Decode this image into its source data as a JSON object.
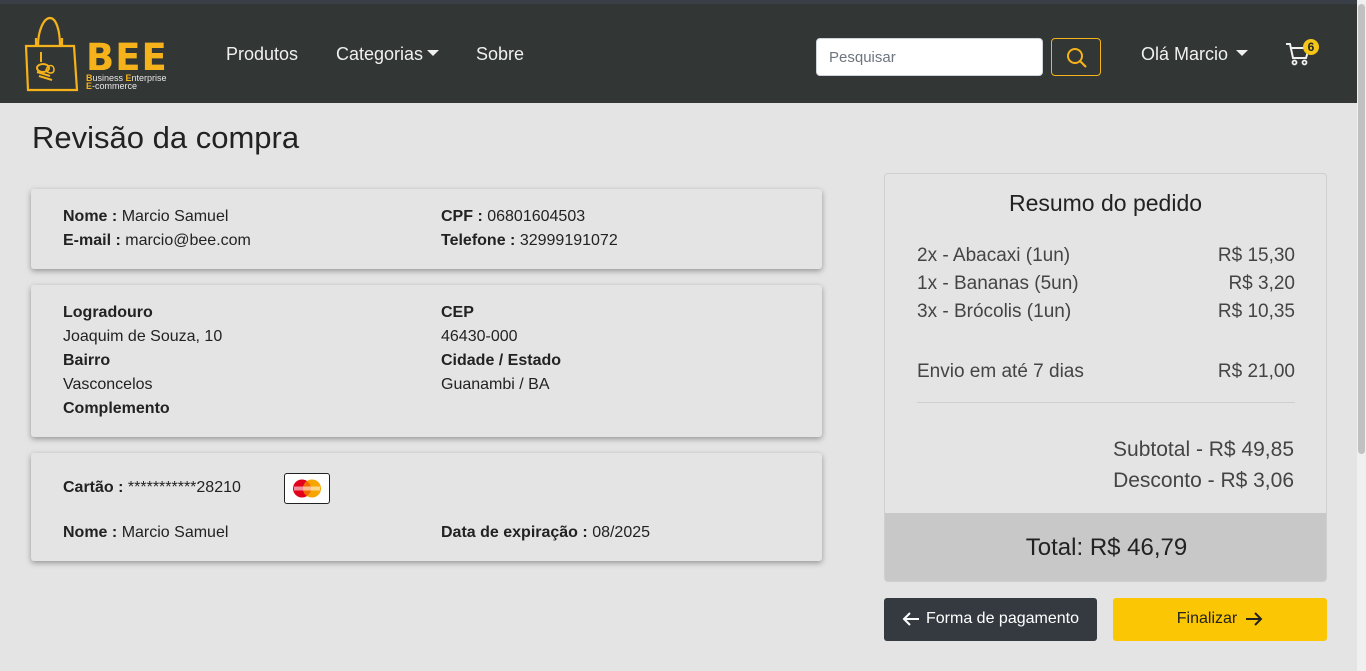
{
  "nav": {
    "brand": "BEE",
    "brand_tag_1_bold": "B",
    "brand_tag_1_rest": "usiness ",
    "brand_tag_1b_bold": "E",
    "brand_tag_1b_rest": "nterprise",
    "brand_tag_2_bold": "E",
    "brand_tag_2_rest": "-commerce",
    "links": [
      {
        "label": "Produtos"
      },
      {
        "label": "Categorias"
      },
      {
        "label": "Sobre"
      }
    ],
    "search_placeholder": "Pesquisar",
    "user_label": "Olá Marcio",
    "cart_count": "6",
    "accent_color": "#f5b21b"
  },
  "page": {
    "title": "Revisão da compra"
  },
  "customer": {
    "name_label": "Nome :",
    "name_value": "Marcio Samuel",
    "email_label": "E-mail :",
    "email_value": "marcio@bee.com",
    "cpf_label": "CPF :",
    "cpf_value": "06801604503",
    "phone_label": "Telefone :",
    "phone_value": "32999191072"
  },
  "address": {
    "street_label": "Logradouro",
    "street_value": "Joaquim de Souza, 10",
    "district_label": "Bairro",
    "district_value": "Vasconcelos",
    "complement_label": "Complemento",
    "zip_label": "CEP",
    "zip_value": "46430-000",
    "city_label": "Cidade / Estado",
    "city_value": "Guanambi / BA"
  },
  "payment": {
    "card_label": "Cartão :",
    "card_value": "***********28210",
    "card_brand_icon": "mastercard-icon",
    "name_label": "Nome :",
    "name_value": "Marcio Samuel",
    "expiry_label": "Data de expiração :",
    "expiry_value": "08/2025"
  },
  "summary": {
    "title": "Resumo do pedido",
    "items": [
      {
        "name": "2x - Abacaxi (1un)",
        "price": "R$ 15,30"
      },
      {
        "name": "1x - Bananas (5un)",
        "price": "R$ 3,20"
      },
      {
        "name": "3x - Brócolis (1un)",
        "price": "R$ 10,35"
      }
    ],
    "shipping_label": "Envio em até 7 dias",
    "shipping_price": "R$ 21,00",
    "subtotal": "Subtotal - R$ 49,85",
    "discount": "Desconto - R$ 3,06",
    "total": "Total: R$ 46,79"
  },
  "actions": {
    "back_label": "Forma de pagamento",
    "finish_label": "Finalizar"
  }
}
